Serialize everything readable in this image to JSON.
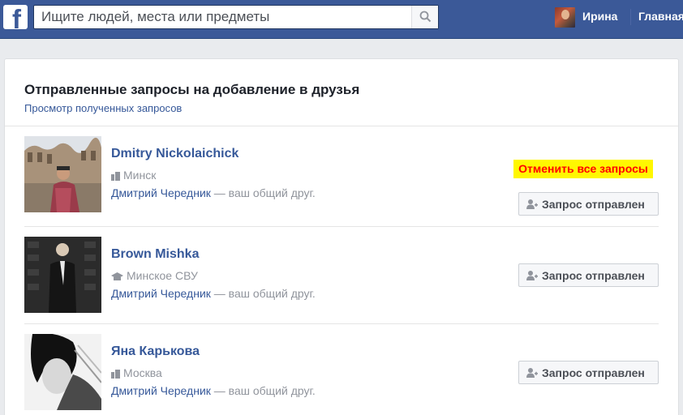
{
  "topbar": {
    "logo_letter": "f",
    "search_placeholder": "Ищите людей, места или предметы",
    "user_name": "Ирина",
    "home_label": "Главная",
    "brand_color": "#3b5998"
  },
  "panel": {
    "title": "Отправленные запросы на добавление в друзья",
    "subtitle": "Просмотр полученных запросов",
    "cancel_all_label": "Отменить все запросы",
    "requests": [
      {
        "name": "Dmitry Nickolaichick",
        "location": "Минск",
        "location_icon": "city-icon",
        "mutual_link": "Дмитрий Чередник",
        "mutual_suffix": " — ваш общий друг.",
        "button_label": "Запрос отправлен"
      },
      {
        "name": "Brown Mishka",
        "location": "Минское СВУ",
        "location_icon": "school-icon",
        "mutual_link": "Дмитрий Чередник",
        "mutual_suffix": " — ваш общий друг.",
        "button_label": "Запрос отправлен"
      },
      {
        "name": "Яна Карькова",
        "location": "Москва",
        "location_icon": "city-icon",
        "mutual_link": "Дмитрий Чередник",
        "mutual_suffix": " — ваш общий друг.",
        "button_label": "Запрос отправлен"
      }
    ]
  }
}
